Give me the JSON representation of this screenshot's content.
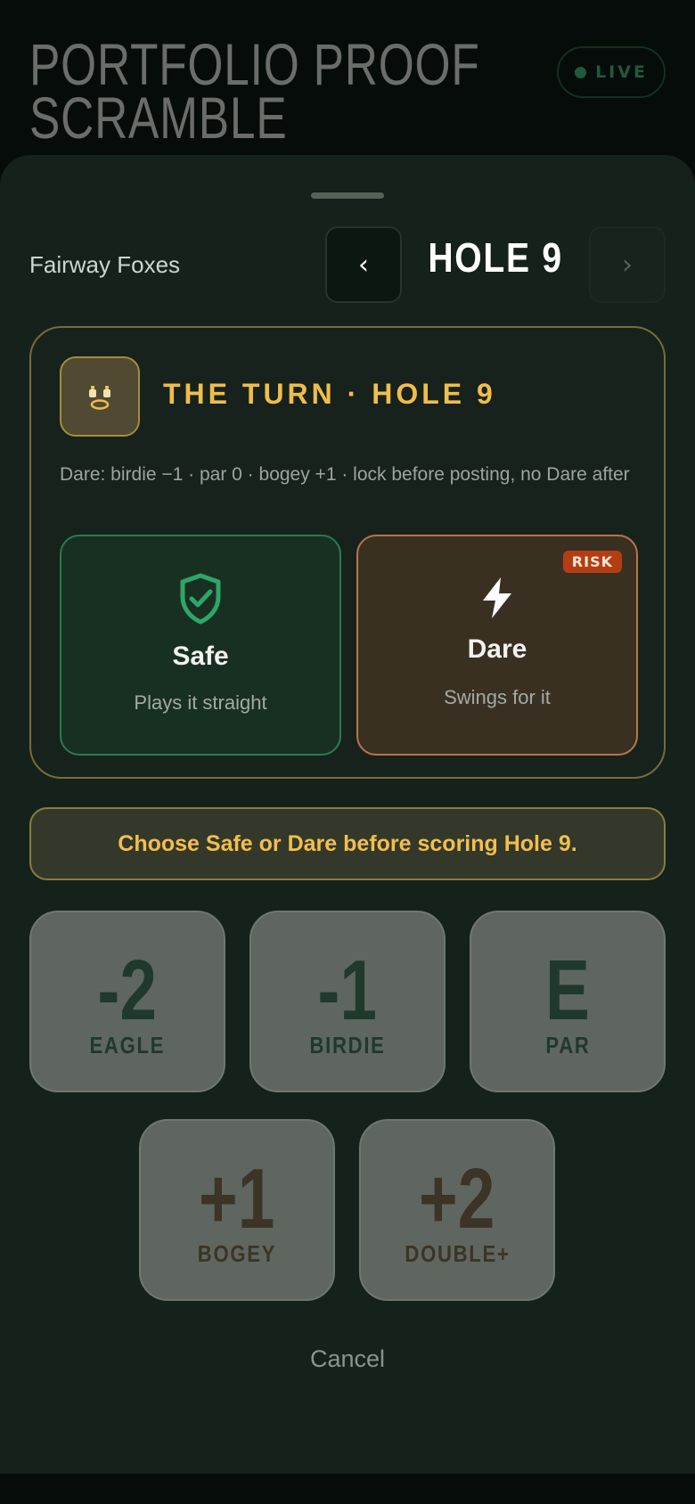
{
  "page": {
    "title": "PORTFOLIO PROOF\nSCRAMBLE",
    "live_label": "LIVE"
  },
  "sheet": {
    "team_name": "Fairway Foxes",
    "prev_icon": "chevron-left-icon",
    "next_icon": "chevron-right-icon",
    "prev_symbol": "‹",
    "next_symbol": "›",
    "hole_title": "HOLE 9"
  },
  "turn": {
    "avatar_icon": "fox-face-icon",
    "heading": "THE TURN · HOLE 9",
    "description": "Dare: birdie −1 · par 0 · bogey +1 · lock before posting, no Dare after",
    "options": {
      "safe": {
        "icon": "shield-check-icon",
        "label": "Safe",
        "subtitle": "Plays it straight"
      },
      "dare": {
        "icon": "lightning-icon",
        "label": "Dare",
        "subtitle": "Swings for it",
        "badge": "RISK"
      }
    }
  },
  "prompt": "Choose Safe or Dare before scoring Hole 9.",
  "scores": [
    {
      "value": "-2",
      "label": "EAGLE"
    },
    {
      "value": "-1",
      "label": "BIRDIE"
    },
    {
      "value": "E",
      "label": "PAR"
    },
    {
      "value": "+1",
      "label": "BOGEY"
    },
    {
      "value": "+2",
      "label": "DOUBLE+"
    }
  ],
  "cancel_label": "Cancel",
  "colors": {
    "accent_gold": "#f0bd4b",
    "safe_green": "#2a7a52",
    "dare_orange": "#b8754b",
    "risk_red": "#b33e12"
  }
}
